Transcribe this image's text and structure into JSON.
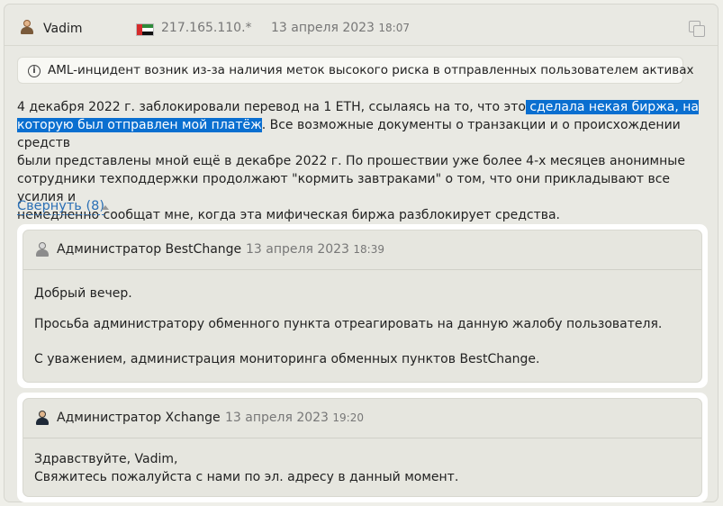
{
  "post": {
    "author": "Vadim",
    "ip": "217.165.110.*",
    "date": "13 апреля 2023",
    "time": "18:07",
    "aml_notice": "AML-инцидент возник из-за наличия меток высокого риска в отправленных пользователем активах",
    "body": {
      "line1_a": "4 декабря 2022 г. заблокировали перевод на 1 ETH, ссылаясь на то, что это",
      "line1_sel": " сделала некая биржа, на",
      "line2_sel": "которую был отправлен мой платёж",
      "line2_b": ". Все возможные документы о транзакции и о происхождении средств",
      "line3": "были представлены мной ещё в декабре 2022 г. По прошествии уже более 4-х месяцев анонимные",
      "line4": "сотрудники техподдержки продолжают \"кормить завтраками\" о том, что они прикладывают все усилия и",
      "line5": "немедленно сообщат мне, когда эта мифическая биржа разблокирует средства."
    },
    "collapse_label": "Свернуть (8)"
  },
  "replies": [
    {
      "author": "Администратор BestChange",
      "date": "13 апреля 2023",
      "time": "18:39",
      "lines": [
        "Добрый вечер.",
        "Просьба администратору обменного пункта отреагировать на данную жалобу пользователя.",
        "С уважением, администрация мониторинга обменных пунктов BestChange."
      ]
    },
    {
      "author": "Администратор Xchange",
      "date": "13 апреля 2023",
      "time": "19:20",
      "lines": [
        "Здравствуйте, Vadim,",
        "Свяжитесь пожалуйста с нами по эл. адресу в данный момент."
      ]
    }
  ],
  "colors": {
    "link": "#2a6fb5",
    "selection": "#0a6fd0",
    "muted": "#777777"
  },
  "icons": {
    "user": "user-avatar-icon",
    "flag": "uae-flag-icon",
    "copy": "copy-icon",
    "info": "info-icon",
    "admin": "admin-avatar-icon",
    "caret": "caret-up-icon"
  }
}
